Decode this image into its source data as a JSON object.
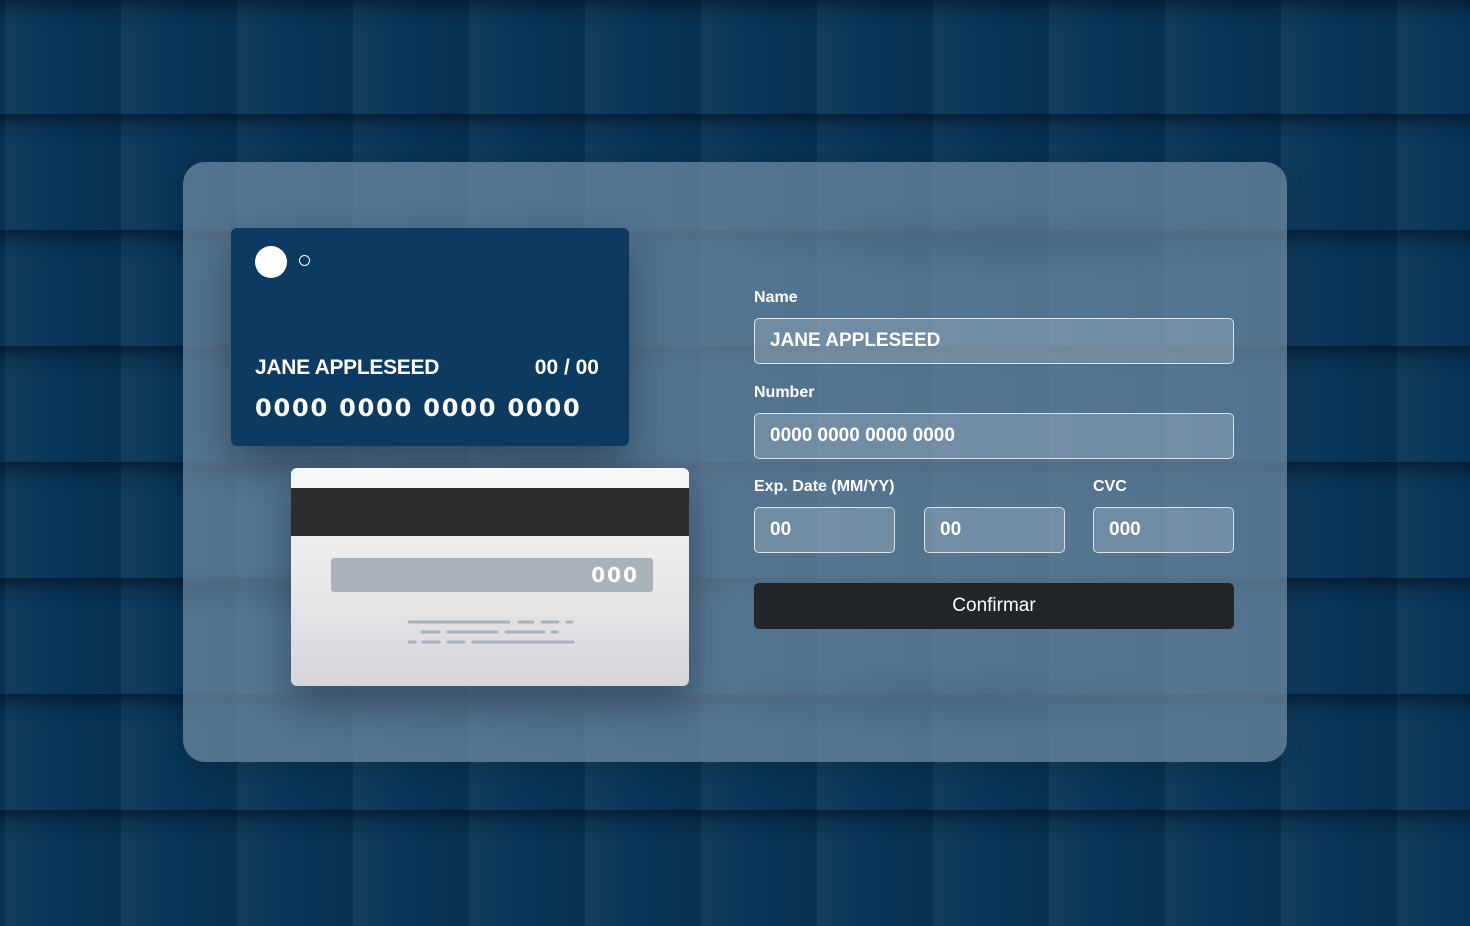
{
  "card_front": {
    "name": "JANE APPLESEED",
    "expiry": "00 / 00",
    "number": "0000 0000 0000 0000"
  },
  "card_back": {
    "cvc": "000"
  },
  "form": {
    "name_label": "Name",
    "name_value": "JANE APPLESEED",
    "number_label": "Number",
    "number_value": "0000 0000 0000 0000",
    "exp_label": "Exp. Date (MM/YY)",
    "exp_month_value": "00",
    "exp_year_value": "00",
    "cvc_label": "CVC",
    "cvc_value": "000",
    "confirm_label": "Confirmar"
  },
  "colors": {
    "background": "#083558",
    "card_front": "#0d3a60",
    "magnetic_stripe": "#2d2d2d",
    "signature_strip": "#a9b1bb",
    "confirm_button": "#222529"
  }
}
